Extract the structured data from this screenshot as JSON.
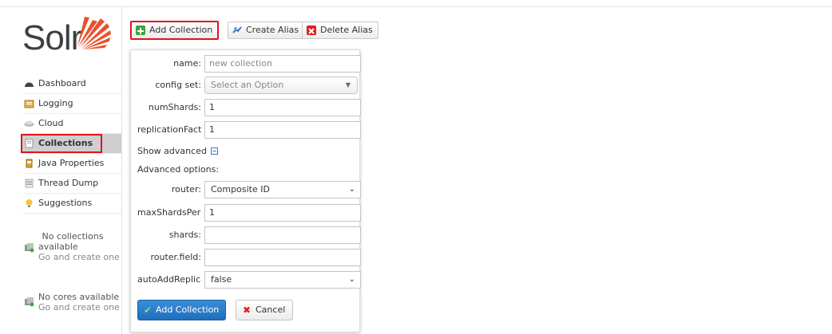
{
  "logo": {
    "text": "Solr"
  },
  "sidebar": {
    "items": [
      {
        "label": "Dashboard",
        "icon": "dashboard-icon"
      },
      {
        "label": "Logging",
        "icon": "logging-icon"
      },
      {
        "label": "Cloud",
        "icon": "cloud-icon"
      },
      {
        "label": "Collections",
        "icon": "collections-icon",
        "active": true
      },
      {
        "label": "Java Properties",
        "icon": "java-properties-icon"
      },
      {
        "label": "Thread Dump",
        "icon": "thread-dump-icon"
      },
      {
        "label": "Suggestions",
        "icon": "suggestions-icon"
      }
    ],
    "collection_selector": {
      "line1": "No collections",
      "line2": "available",
      "line3": "Go and create one"
    },
    "core_selector": {
      "line1": "No cores available",
      "line2": "Go and create one"
    }
  },
  "toolbar": {
    "add_collection": "Add Collection",
    "create_alias": "Create Alias",
    "delete_alias": "Delete Alias"
  },
  "form": {
    "name": {
      "label": "name:",
      "value": "new collection"
    },
    "config_set": {
      "label": "config set:",
      "placeholder": "Select an Option"
    },
    "num_shards": {
      "label": "numShards:",
      "value": "1"
    },
    "replication_factor": {
      "label": "replicationFact",
      "value": "1"
    },
    "show_advanced": "Show advanced",
    "advanced_options": "Advanced options:",
    "router": {
      "label": "router:",
      "value": "Composite ID"
    },
    "max_shards_per_node": {
      "label": "maxShardsPer",
      "value": "1"
    },
    "shards": {
      "label": "shards:",
      "value": ""
    },
    "router_field": {
      "label": "router.field:",
      "value": ""
    },
    "auto_add_replicas": {
      "label": "autoAddReplica",
      "value": "false"
    },
    "submit": "Add Collection",
    "cancel": "Cancel"
  },
  "colors": {
    "primary": "#1e6fbd",
    "highlight": "#e0141e",
    "logo_accent": "#e8522a"
  }
}
